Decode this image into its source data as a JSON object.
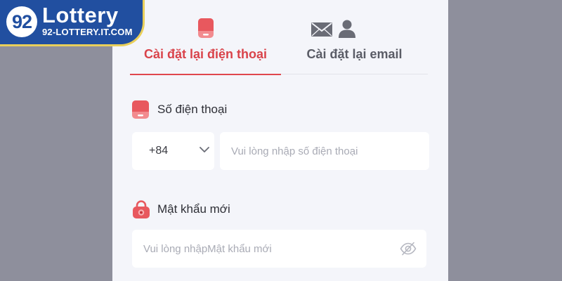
{
  "logo": {
    "mark": "92",
    "title": "Lottery",
    "url": "92-LOTTERY.IT.COM"
  },
  "tabs": [
    {
      "label": "Cài đặt lại điện thoại",
      "icon": "phone-icon",
      "active": true
    },
    {
      "label": "Cài đặt lại email",
      "icon": "mail-icon",
      "active": false
    }
  ],
  "phone_field": {
    "label": "Số điện thoại",
    "icon": "phone-icon",
    "country_code": "+84",
    "placeholder": "Vui lòng nhập số điện thoại",
    "value": ""
  },
  "password_field": {
    "label": "Mật khẩu mới",
    "icon": "lock-icon",
    "placeholder": "Vui lòng nhậpMật khẩu mới",
    "value": ""
  },
  "colors": {
    "accent": "#e0474d",
    "panel_bg": "#f4f5fa",
    "page_bg": "#8e8f9c",
    "logo_bg": "#214fa0",
    "logo_border": "#e9cf5a"
  }
}
